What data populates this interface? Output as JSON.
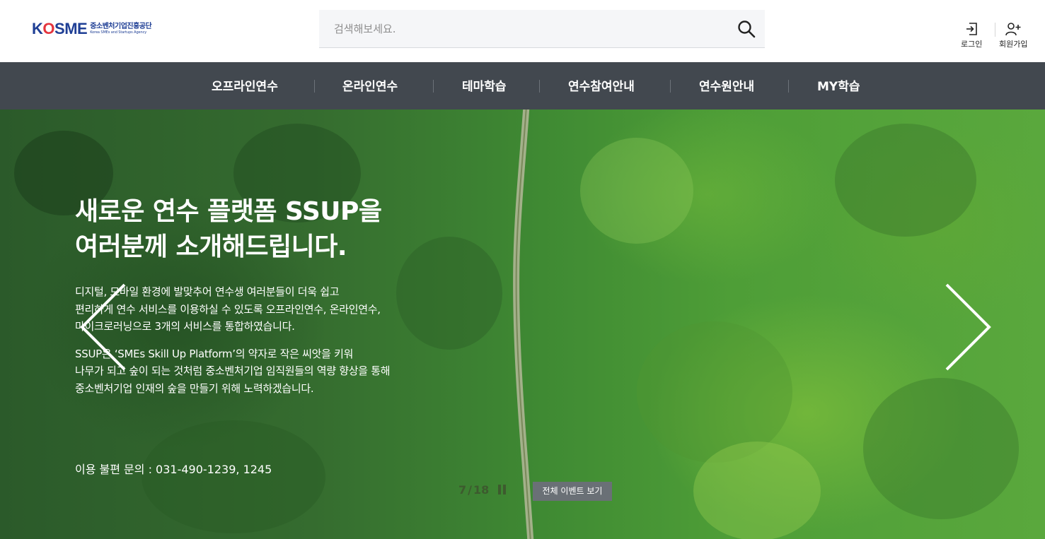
{
  "header": {
    "logo": {
      "wordmark_k": "K",
      "wordmark_o": "O",
      "wordmark_rest": "SME",
      "org_name_ko": "중소벤처기업진흥공단",
      "org_name_en": "Korea SMEs and Startups Agency"
    },
    "search": {
      "placeholder": "검색해보세요.",
      "value": ""
    },
    "util": {
      "login_label": "로그인",
      "join_label": "회원가입"
    }
  },
  "gnb": {
    "items": [
      "오프라인연수",
      "온라인연수",
      "테마학습",
      "연수참여안내",
      "연수원안내",
      "MY학습"
    ]
  },
  "hero": {
    "title_line1": "새로운 연수 플랫폼 SSUP을",
    "title_line2": "여러분께 소개해드립니다.",
    "para1": [
      "디지털, 모바일 환경에 발맞추어 연수생 여러분들이 더욱 쉽고",
      "편리하게 연수 서비스를 이용하실 수 있도록 오프라인연수, 온라인연수,",
      "마이크로러닝으로 3개의 서비스를 통합하였습니다."
    ],
    "para2": [
      "SSUP은 ‘SMEs Skill Up Platform’의 약자로 작은 씨앗을 키워",
      "나무가 되고 숲이 되는 것처럼 중소벤처기업 임직원들의 역량 향상을 통해",
      "중소벤처기업 인재의 숲을 만들기 위해 노력하겠습니다."
    ],
    "contact": "이용 불편 문의 : 031-490-1239, 1245",
    "pager": {
      "current": "7",
      "separator": "/",
      "total": "18"
    },
    "event_button": "전체 이벤트 보기"
  },
  "colors": {
    "brand_blue": "#1f3f95",
    "brand_red": "#e4343d",
    "gnb_bg": "#42484f",
    "event_btn_bg": "#6a7076"
  },
  "icons": [
    "search-icon",
    "login-icon",
    "add-user-icon",
    "chevron-left-icon",
    "chevron-right-icon",
    "pause-icon"
  ]
}
